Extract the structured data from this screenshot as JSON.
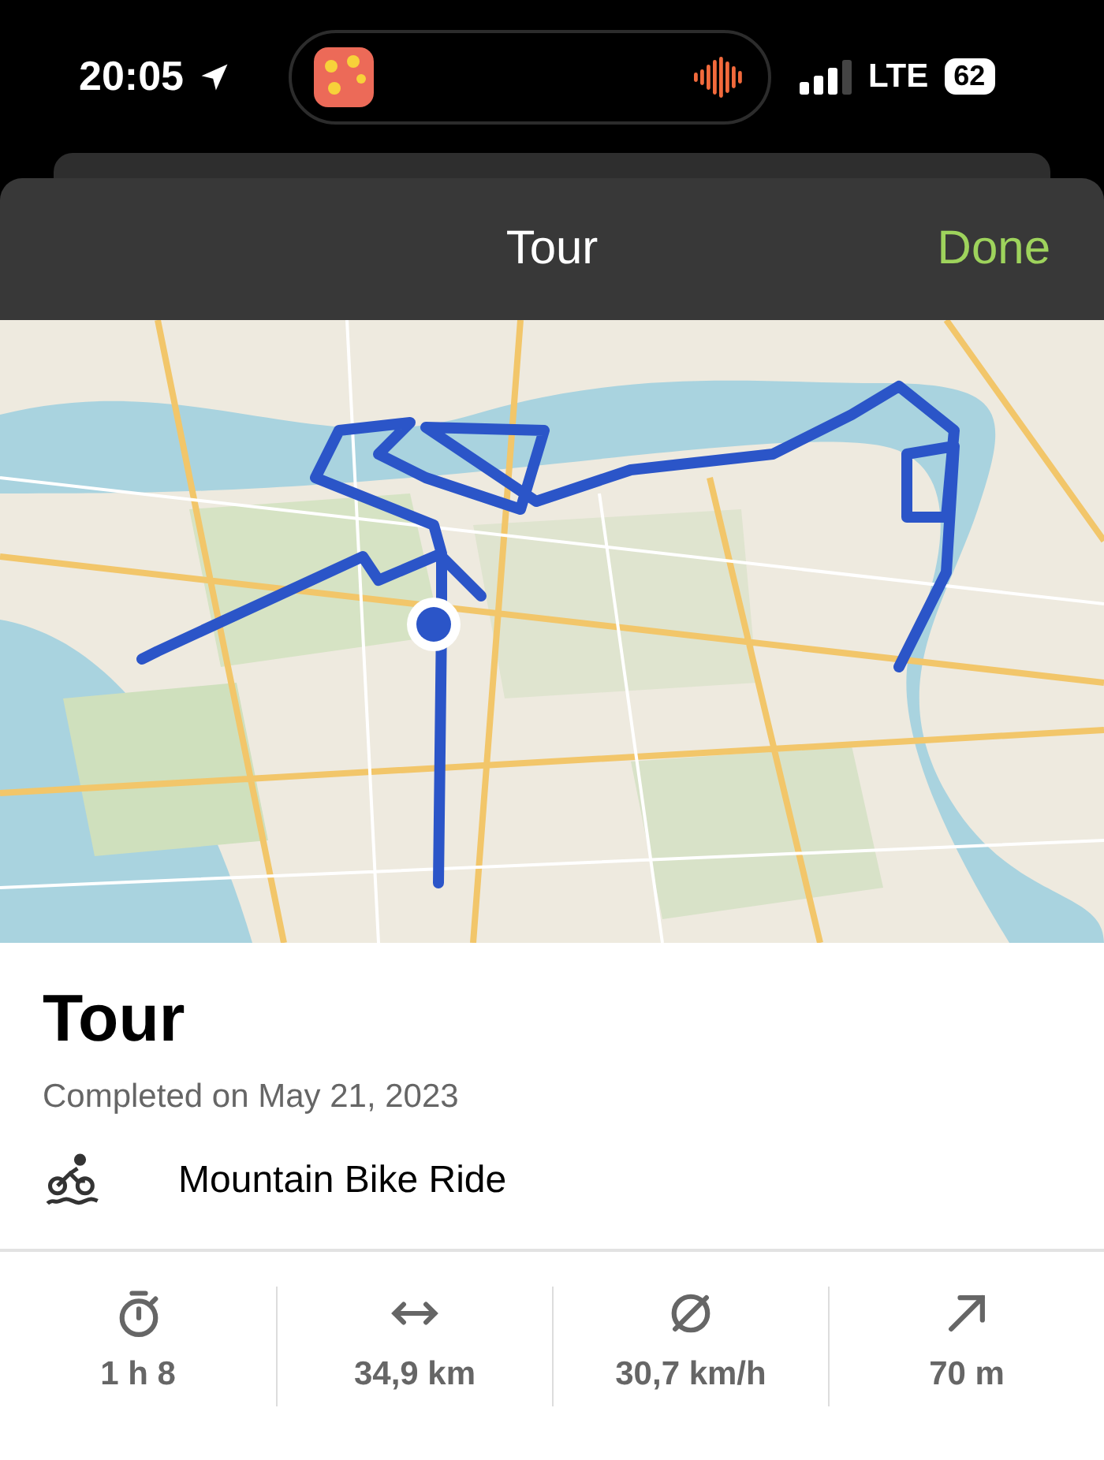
{
  "status_bar": {
    "time": "20:05",
    "network": "LTE",
    "battery": "62"
  },
  "header": {
    "title": "Tour",
    "done": "Done"
  },
  "tour": {
    "title": "Tour",
    "completed": "Completed on May 21, 2023",
    "activity": "Mountain Bike Ride"
  },
  "stats": [
    {
      "kind": "duration",
      "value": "1 h 8"
    },
    {
      "kind": "distance",
      "value": "34,9 km"
    },
    {
      "kind": "speed",
      "value": "30,7 km/h"
    },
    {
      "kind": "elevation",
      "value": "70 m"
    }
  ]
}
